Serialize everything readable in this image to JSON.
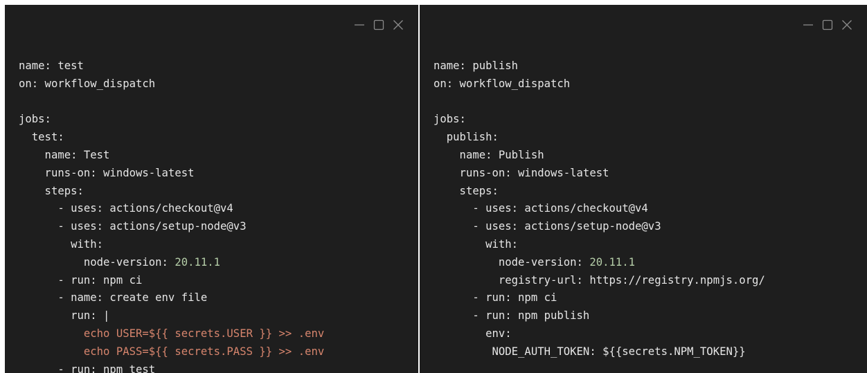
{
  "colors": {
    "background": "#1e1e1e",
    "text": "#e6e6e6",
    "number": "#b5cea8",
    "string": "#d7856d",
    "window_controls": "#8a8a8a"
  },
  "panes": [
    {
      "window_controls": [
        "minimize-icon",
        "maximize-icon",
        "close-icon"
      ],
      "lines": [
        [
          {
            "t": "name: test",
            "c": "key"
          }
        ],
        [
          {
            "t": "on: workflow_dispatch",
            "c": "key"
          }
        ],
        [
          {
            "t": "",
            "c": "key"
          }
        ],
        [
          {
            "t": "jobs:",
            "c": "key"
          }
        ],
        [
          {
            "t": "  test:",
            "c": "key"
          }
        ],
        [
          {
            "t": "    name: Test",
            "c": "key"
          }
        ],
        [
          {
            "t": "    runs-on: windows-latest",
            "c": "key"
          }
        ],
        [
          {
            "t": "    steps:",
            "c": "key"
          }
        ],
        [
          {
            "t": "      - uses: actions/checkout@v4",
            "c": "key"
          }
        ],
        [
          {
            "t": "      - uses: actions/setup-node@v3",
            "c": "key"
          }
        ],
        [
          {
            "t": "        with:",
            "c": "key"
          }
        ],
        [
          {
            "t": "          node-version: ",
            "c": "key"
          },
          {
            "t": "20.11.1",
            "c": "num"
          }
        ],
        [
          {
            "t": "      - run: npm ci",
            "c": "key"
          }
        ],
        [
          {
            "t": "      - name: create env file",
            "c": "key"
          }
        ],
        [
          {
            "t": "        run: |",
            "c": "key"
          }
        ],
        [
          {
            "t": "          echo USER=${{ secrets.USER }} >> .env",
            "c": "str"
          }
        ],
        [
          {
            "t": "          echo PASS=${{ secrets.PASS }} >> .env",
            "c": "str"
          }
        ],
        [
          {
            "t": "      - run: npm test",
            "c": "key"
          }
        ]
      ]
    },
    {
      "window_controls": [
        "minimize-icon",
        "maximize-icon",
        "close-icon"
      ],
      "lines": [
        [
          {
            "t": "name: publish",
            "c": "key"
          }
        ],
        [
          {
            "t": "on: workflow_dispatch",
            "c": "key"
          }
        ],
        [
          {
            "t": "",
            "c": "key"
          }
        ],
        [
          {
            "t": "jobs:",
            "c": "key"
          }
        ],
        [
          {
            "t": "  publish:",
            "c": "key"
          }
        ],
        [
          {
            "t": "    name: Publish",
            "c": "key"
          }
        ],
        [
          {
            "t": "    runs-on: windows-latest",
            "c": "key"
          }
        ],
        [
          {
            "t": "    steps:",
            "c": "key"
          }
        ],
        [
          {
            "t": "      - uses: actions/checkout@v4",
            "c": "key"
          }
        ],
        [
          {
            "t": "      - uses: actions/setup-node@v3",
            "c": "key"
          }
        ],
        [
          {
            "t": "        with:",
            "c": "key"
          }
        ],
        [
          {
            "t": "          node-version: ",
            "c": "key"
          },
          {
            "t": "20.11.1",
            "c": "num"
          }
        ],
        [
          {
            "t": "          registry-url: https://registry.npmjs.org/",
            "c": "key"
          }
        ],
        [
          {
            "t": "      - run: npm ci",
            "c": "key"
          }
        ],
        [
          {
            "t": "      - run: npm publish",
            "c": "key"
          }
        ],
        [
          {
            "t": "        env:",
            "c": "key"
          }
        ],
        [
          {
            "t": "         NODE_AUTH_TOKEN: ${{secrets.NPM_TOKEN}}",
            "c": "key"
          }
        ]
      ]
    }
  ]
}
